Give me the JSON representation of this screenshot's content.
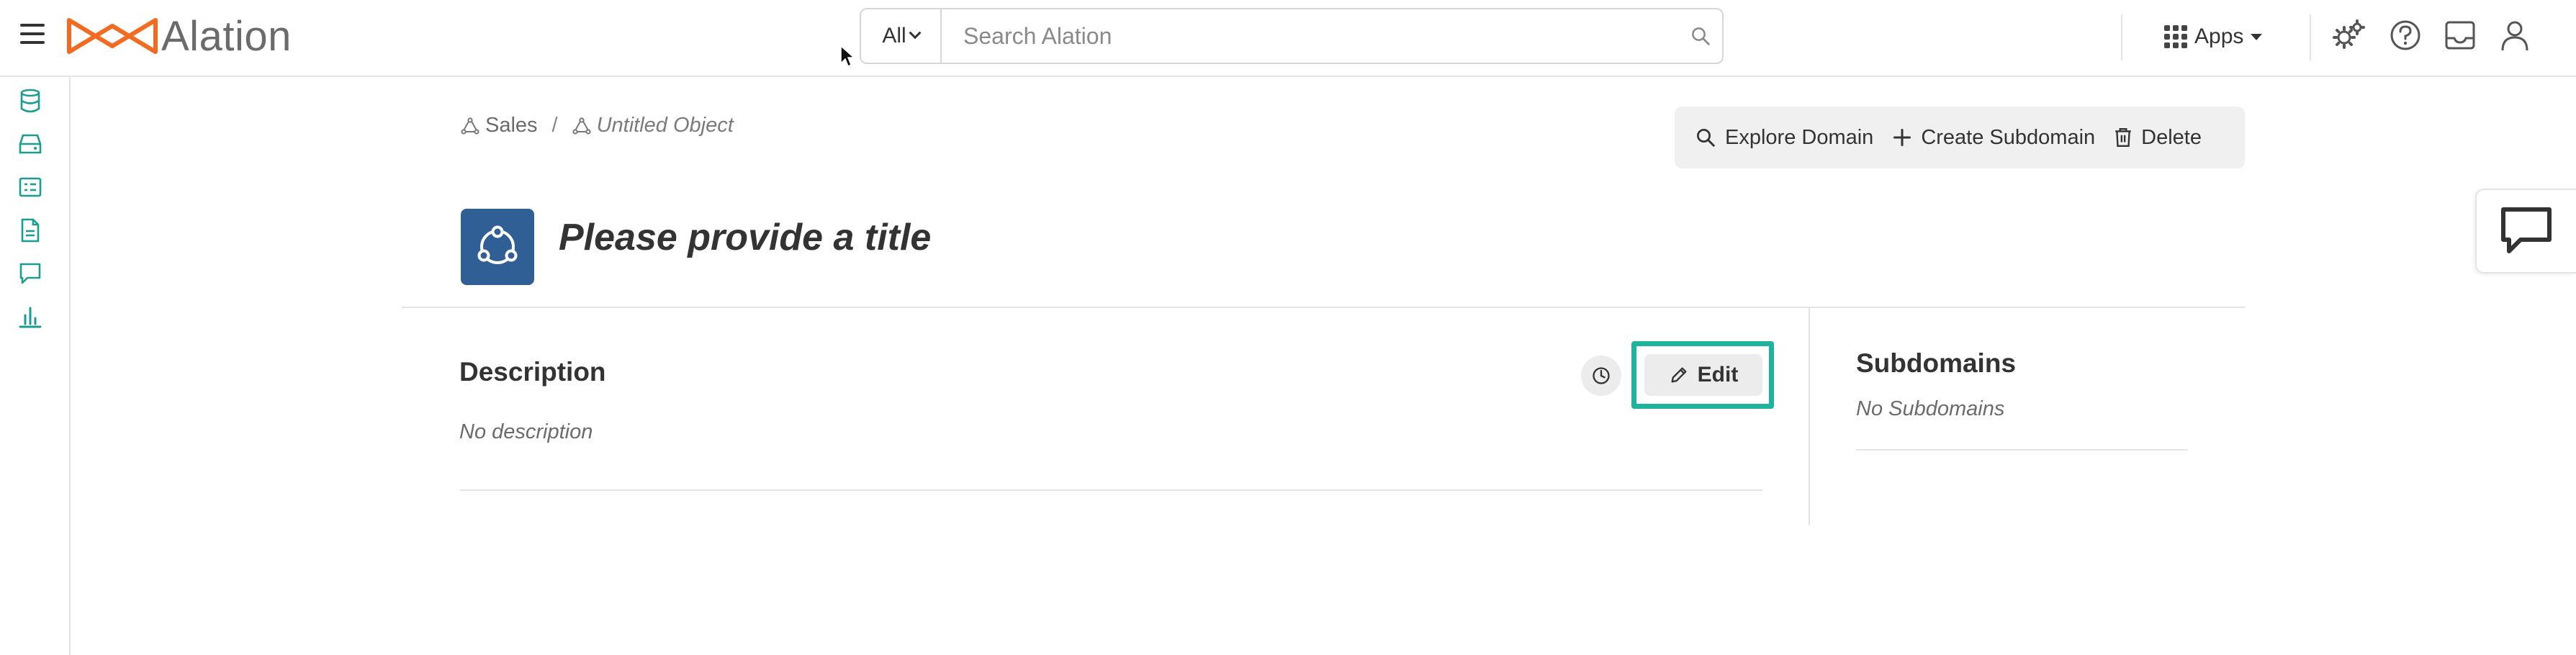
{
  "topbar": {
    "brand": "Alation",
    "search": {
      "scope": "All",
      "placeholder": "Search Alation"
    },
    "apps_label": "Apps",
    "icons": [
      "menu-icon",
      "admin-settings-icon",
      "help-icon",
      "inbox-icon",
      "user-icon"
    ]
  },
  "leftnav": {
    "icons": [
      "database-icon",
      "storage-icon",
      "catalog-icon",
      "document-icon",
      "conversations-icon",
      "analytics-icon"
    ],
    "accent": "#1a9e8f"
  },
  "breadcrumb": {
    "root": "Sales",
    "separator": "/",
    "current": "Untitled Object"
  },
  "actions": {
    "explore": "Explore Domain",
    "create": "Create Subdomain",
    "delete": "Delete"
  },
  "page": {
    "title": "Please provide a title",
    "icon_color": "#2f5f95"
  },
  "description": {
    "heading": "Description",
    "empty": "No description",
    "edit_label": "Edit",
    "highlight_color": "#1fb39e"
  },
  "subdomains": {
    "heading": "Subdomains",
    "empty": "No Subdomains"
  }
}
